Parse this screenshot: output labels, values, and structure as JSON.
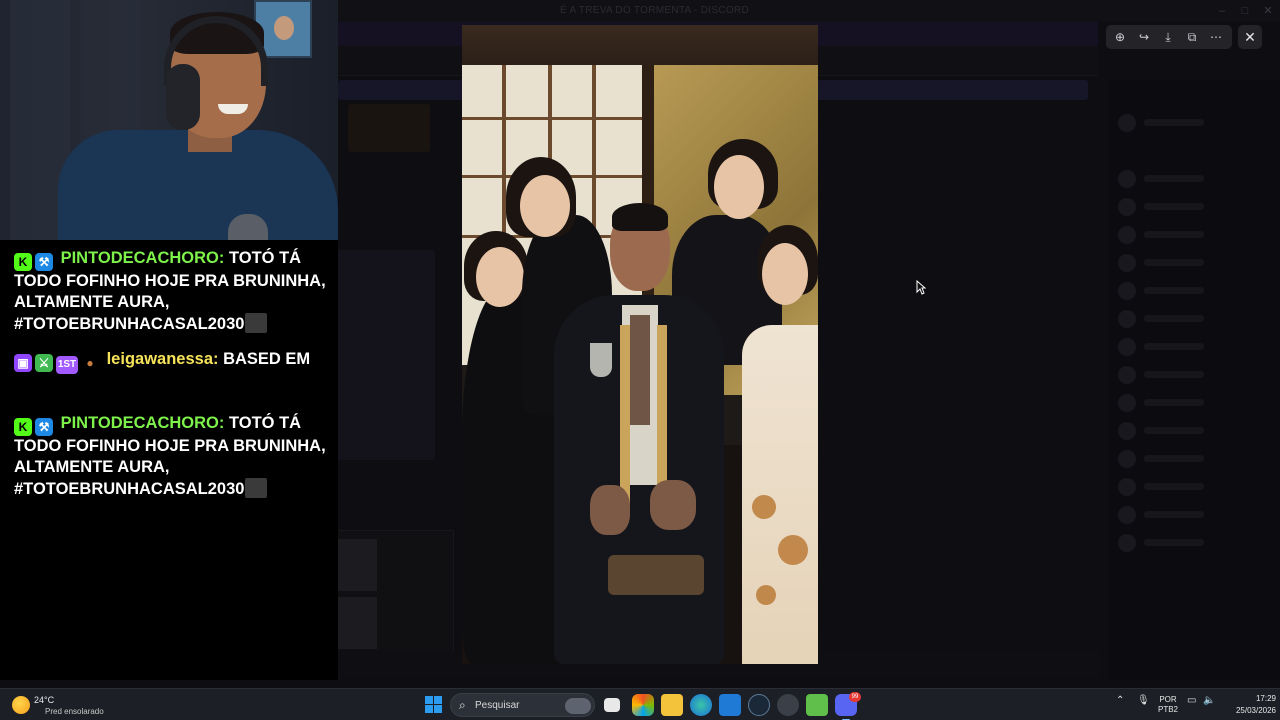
{
  "background_window": {
    "title": "É A TREVA DO TORMENTA - DISCORD"
  },
  "chat": {
    "messages": [
      {
        "username": "PINTODECACHORO:",
        "username_color": "#7ef24a",
        "text": "TOTÓ TÁ TODO FOFINHO HOJE PRA BRUNINHA, ALTAMENTE AURA, #TOTOEBRUNHACASAL2030",
        "badges": [
          "kick-icon",
          "hammer-icon"
        ]
      },
      {
        "username": "leigawanessa:",
        "username_color": "#f7e35a",
        "text": "BASED EM",
        "badges": [
          "twitch-icon",
          "sword-icon",
          "first-badge",
          "food-icon"
        ],
        "first_badge_text": "1ST"
      },
      {
        "username": "PINTODECACHORO:",
        "username_color": "#7ef24a",
        "text": "TOTÓ TÁ TODO FOFINHO HOJE PRA BRUNINHA, ALTAMENTE AURA, #TOTOEBRUNHACASAL2030",
        "badges": [
          "kick-icon",
          "hammer-icon"
        ]
      }
    ]
  },
  "viewer_toolbar": {
    "buttons": [
      "zoom-in-icon",
      "share-icon",
      "download-icon",
      "open-external-icon",
      "more-icon"
    ],
    "close": "close-icon"
  },
  "taskbar": {
    "weather_temp": "24°C",
    "weather_condition": "Pred ensolarado",
    "search_placeholder": "Pesquisar",
    "language_line1": "POR",
    "language_line2": "PTB2",
    "time": "17:29",
    "date": "25/03/2026",
    "discord_badge": "99"
  }
}
